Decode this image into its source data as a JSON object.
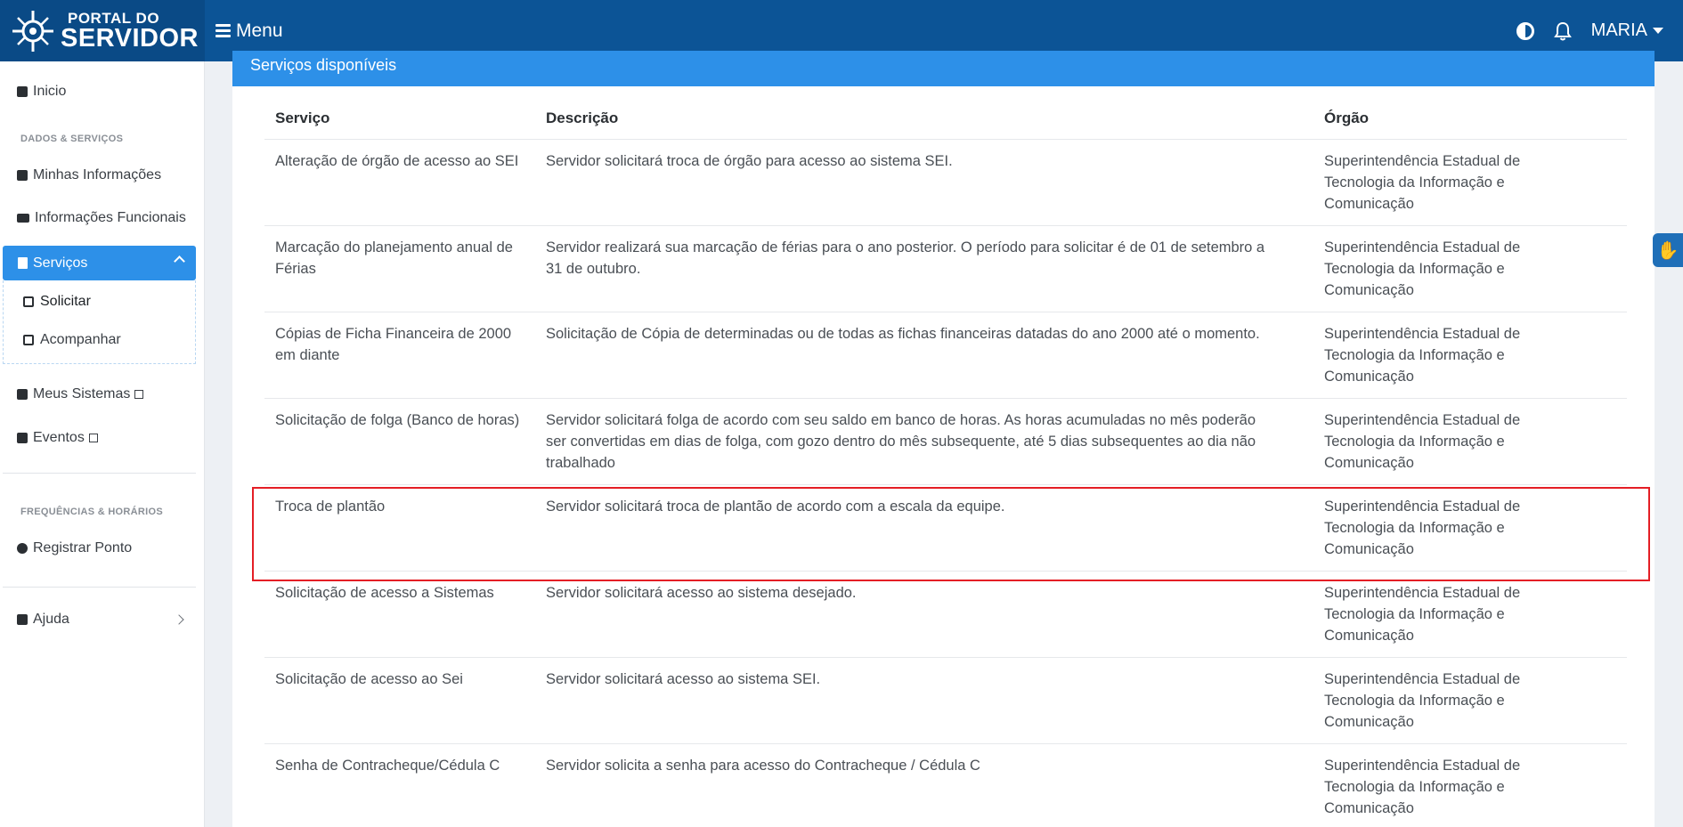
{
  "header": {
    "logo_line1": "PORTAL DO",
    "logo_line2": "SERVIDOR",
    "menu_label": "Menu",
    "user_name": "MARIA"
  },
  "sidebar": {
    "inicio": "Inicio",
    "section_dados": "DADOS & SERVIÇOS",
    "minhas_info": "Minhas Informações",
    "info_funcionais": "Informações Funcionais",
    "servicos": "Serviços",
    "solicitar": "Solicitar",
    "acompanhar": "Acompanhar",
    "meus_sistemas": "Meus Sistemas",
    "eventos": "Eventos",
    "section_freq": "FREQUÊNCIAS & HORÁRIOS",
    "registrar_ponto": "Registrar Ponto",
    "ajuda": "Ajuda"
  },
  "main": {
    "card_title": "Serviços disponíveis",
    "columns": [
      "Serviço",
      "Descrição",
      "Órgão"
    ],
    "rows": [
      {
        "servico": "Alteração de órgão de acesso ao SEI",
        "descricao": "Servidor solicitará troca de órgão para acesso ao sistema SEI.",
        "orgao": "Superintendência Estadual de Tecnologia da Informação e Comunicação"
      },
      {
        "servico": "Marcação do planejamento anual de Férias",
        "descricao": "Servidor realizará sua marcação de férias para o ano posterior. O período para solicitar é de 01 de setembro a 31 de outubro.",
        "orgao": "Superintendência Estadual de Tecnologia da Informação e Comunicação"
      },
      {
        "servico": "Cópias de Ficha Financeira de 2000 em diante",
        "descricao": "Solicitação de Cópia de determinadas ou de todas as fichas financeiras datadas do ano 2000 até o momento.",
        "orgao": "Superintendência Estadual de Tecnologia da Informação e Comunicação"
      },
      {
        "servico": "Solicitação de folga (Banco de horas)",
        "descricao": "Servidor solicitará folga de acordo com seu saldo em banco de horas. As horas acumuladas no mês poderão ser convertidas em dias de folga, com gozo dentro do mês subsequente, até 5 dias subsequentes ao dia não trabalhado",
        "orgao": "Superintendência Estadual de Tecnologia da Informação e Comunicação"
      },
      {
        "servico": "Troca de plantão",
        "descricao": "Servidor solicitará troca de plantão de acordo com a escala da equipe.",
        "orgao": "Superintendência Estadual de Tecnologia da Informação e Comunicação"
      },
      {
        "servico": "Solicitação de acesso a Sistemas",
        "descricao": "Servidor solicitará acesso ao sistema desejado.",
        "orgao": "Superintendência Estadual de Tecnologia da Informação e Comunicação"
      },
      {
        "servico": "Solicitação de acesso ao Sei",
        "descricao": "Servidor solicitará acesso ao sistema SEI.",
        "orgao": "Superintendência Estadual de Tecnologia da Informação e Comunicação"
      },
      {
        "servico": "Senha de Contracheque/Cédula C",
        "descricao": "Servidor solicita a senha para acesso do Contracheque / Cédula C",
        "orgao": "Superintendência Estadual de Tecnologia da Informação e Comunicação"
      }
    ]
  },
  "colors": {
    "topbar": "#0c5496",
    "accent": "#2d90e8",
    "highlight": "#e41e25"
  }
}
